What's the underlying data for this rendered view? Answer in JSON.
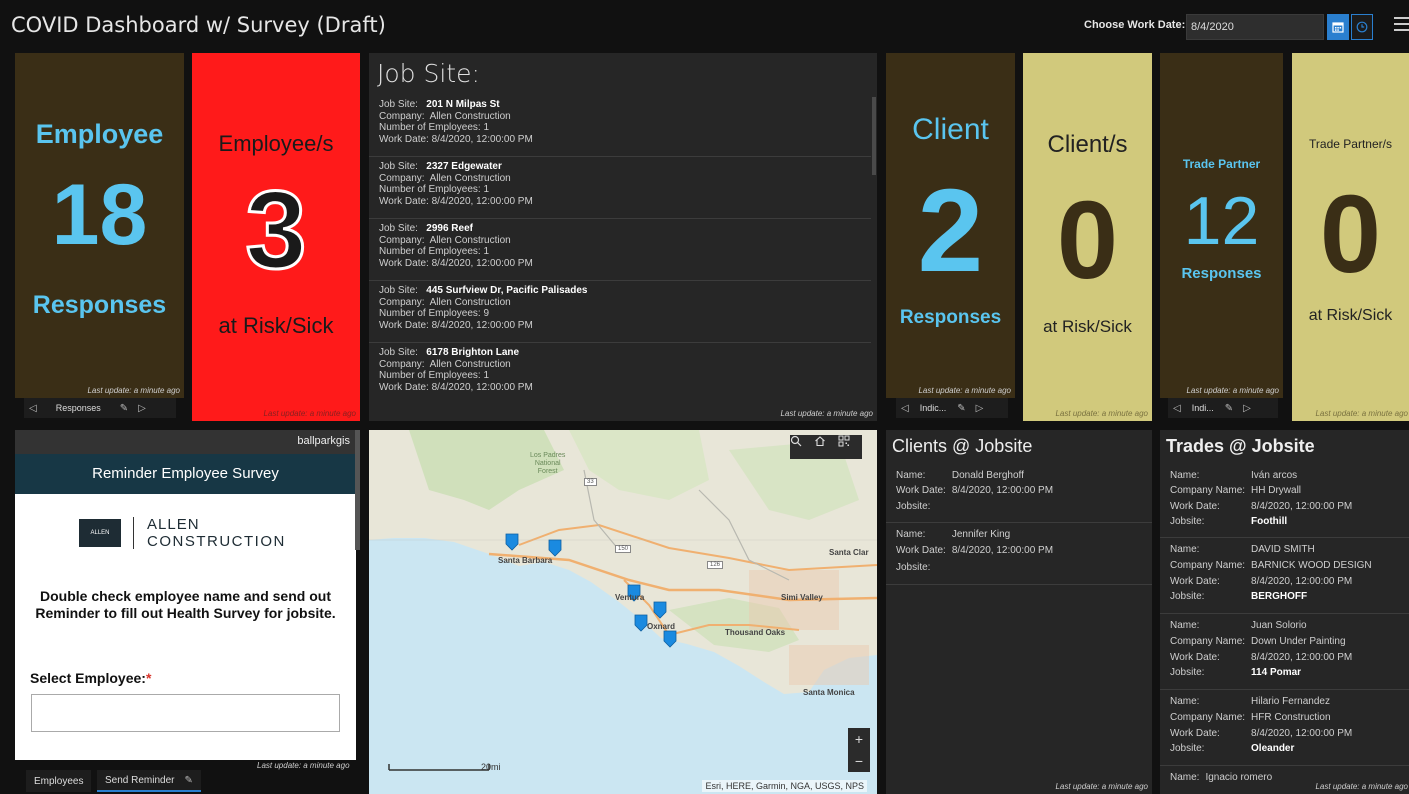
{
  "header": {
    "title": "COVID Dashboard w/ Survey (Draft)",
    "date_label": "Choose Work Date:",
    "date_value": "8/4/2020"
  },
  "icons": {
    "calendar": "calendar-icon",
    "clock": "clock-icon",
    "menu": "hamburger-menu-icon"
  },
  "colors": {
    "olive": "#3a2e16",
    "khaki": "#d1c97c",
    "red": "#ff1a1a",
    "cyan": "#5ac5ef",
    "navy": "#173745",
    "accent": "#2a7fcf"
  },
  "last_update": "Last update: a minute ago",
  "indicators": {
    "employee": {
      "top": "Employee",
      "value": "18",
      "bottom": "Responses"
    },
    "employee_risk": {
      "top": "Employee/s",
      "value": "3",
      "bottom": "at Risk/Sick"
    },
    "client": {
      "top": "Client",
      "value": "2",
      "bottom": "Responses"
    },
    "client_risk": {
      "top": "Client/s",
      "value": "0",
      "bottom": "at Risk/Sick"
    },
    "trade": {
      "top": "Trade Partner",
      "value": "12",
      "bottom": "Responses"
    },
    "trade_risk": {
      "top": "Trade Partner/s",
      "value": "0",
      "bottom": "at Risk/Sick"
    }
  },
  "pagers": {
    "employee": "Responses",
    "client": "Indic...",
    "trade": "Indi..."
  },
  "jobsite": {
    "title": "Job Site:",
    "labels": {
      "site": "Job Site:",
      "company": "Company:",
      "employees": "Number of Employees:",
      "date": "Work Date:"
    },
    "items": [
      {
        "site": "201 N Milpas St",
        "company": "Allen Construction",
        "employees": "1",
        "date": "8/4/2020, 12:00:00 PM"
      },
      {
        "site": "2327 Edgewater",
        "company": "Allen Construction",
        "employees": "1",
        "date": "8/4/2020, 12:00:00 PM"
      },
      {
        "site": "2996 Reef",
        "company": "Allen Construction",
        "employees": "1",
        "date": "8/4/2020, 12:00:00 PM"
      },
      {
        "site": "445 Surfview Dr, Pacific Palisades",
        "company": "Allen Construction",
        "employees": "9",
        "date": "8/4/2020, 12:00:00 PM"
      },
      {
        "site": "6178 Brighton Lane",
        "company": "Allen Construction",
        "employees": "1",
        "date": "8/4/2020, 12:00:00 PM"
      }
    ]
  },
  "survey": {
    "user": "ballparkgis",
    "header": "Reminder Employee Survey",
    "logo_small": "ALLEN",
    "logo_line1": "ALLEN",
    "logo_line2": "CONSTRUCTION",
    "instructions": "Double check employee name and send out Reminder to fill out Health Survey for jobsite.",
    "select_label": "Select Employee:",
    "required_mark": "*",
    "employee_value": ""
  },
  "footer_tabs": {
    "employees": "Employees",
    "send_reminder": "Send Reminder"
  },
  "map": {
    "labels": {
      "los_padres": "Los Padres",
      "national": "National",
      "forest": "Forest",
      "santa_barbara": "Santa Barbara",
      "ventura": "Ventura",
      "oxnard": "Oxnard",
      "simi_valley": "Simi Valley",
      "thousand_oaks": "Thousand Oaks",
      "santa_clarita": "Santa Clar",
      "santa_monica": "Santa Monica",
      "hwy_33": "33",
      "hwy_150": "150",
      "hwy_126": "126"
    },
    "scale": "20mi",
    "attribution": "Esri, HERE, Garmin, NGA, USGS, NPS",
    "zoom_in": "+",
    "zoom_out": "−",
    "markers": 6
  },
  "clients": {
    "title": "Clients @ Jobsite",
    "labels": {
      "name": "Name:",
      "date": "Work Date:",
      "jobsite": "Jobsite:"
    },
    "items": [
      {
        "name": "Donald Berghoff",
        "date": "8/4/2020, 12:00:00 PM",
        "jobsite": ""
      },
      {
        "name": "Jennifer King",
        "date": "8/4/2020, 12:00:00 PM",
        "jobsite": ""
      }
    ]
  },
  "trades": {
    "title": "Trades @ Jobsite",
    "labels": {
      "name": "Name:",
      "company": "Company Name:",
      "date": "Work Date:",
      "jobsite": "Jobsite:"
    },
    "items": [
      {
        "name": "Iván arcos",
        "company": "HH Drywall",
        "date": "8/4/2020, 12:00:00 PM",
        "jobsite": "Foothill"
      },
      {
        "name": "DAVID SMITH",
        "company": "BARNICK WOOD DESIGN",
        "date": "8/4/2020, 12:00:00 PM",
        "jobsite": "BERGHOFF"
      },
      {
        "name": "Juan Solorio",
        "company": "Down Under Painting",
        "date": "8/4/2020, 12:00:00 PM",
        "jobsite": "114 Pomar"
      },
      {
        "name": "Hilario Fernandez",
        "company": "HFR Construction",
        "date": "8/4/2020, 12:00:00 PM",
        "jobsite": "Oleander"
      },
      {
        "name": "Ignacio romero",
        "company": "",
        "date": "",
        "jobsite": ""
      }
    ]
  }
}
